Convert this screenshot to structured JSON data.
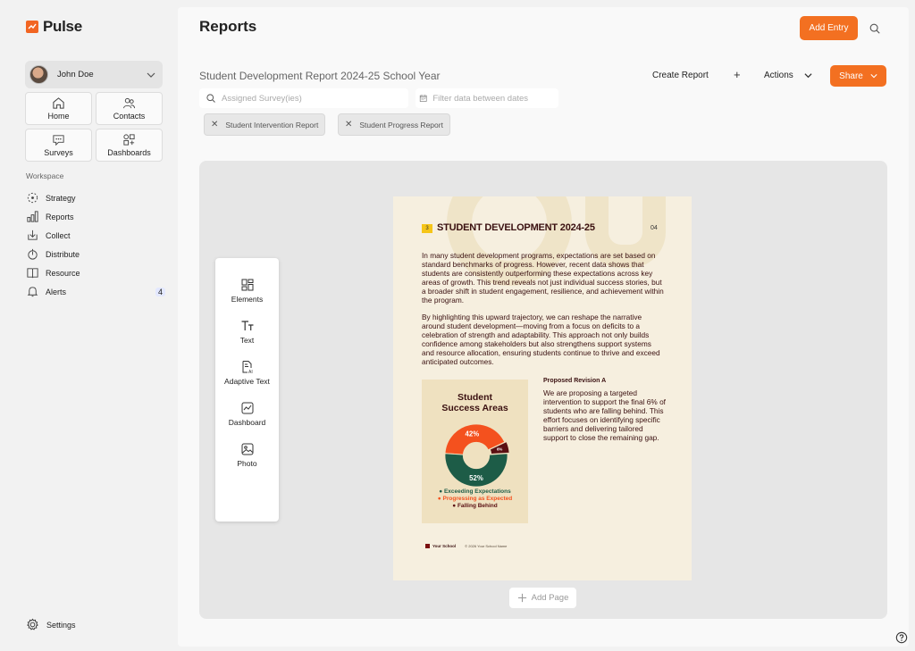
{
  "app": {
    "name": "Pulse",
    "accent": "#f37021"
  },
  "user": {
    "name": "John Doe"
  },
  "nav": {
    "tiles": [
      {
        "label": "Home",
        "icon": "home-icon"
      },
      {
        "label": "Contacts",
        "icon": "contacts-icon"
      },
      {
        "label": "Surveys",
        "icon": "surveys-icon"
      },
      {
        "label": "Dashboards",
        "icon": "dashboards-icon"
      }
    ],
    "workspace_label": "Workspace",
    "workspace": [
      {
        "label": "Strategy",
        "icon": "strategy-icon"
      },
      {
        "label": "Reports",
        "icon": "reports-icon"
      },
      {
        "label": "Collect",
        "icon": "collect-icon"
      },
      {
        "label": "Distribute",
        "icon": "distribute-icon"
      },
      {
        "label": "Resource",
        "icon": "resource-icon"
      },
      {
        "label": "Alerts",
        "icon": "alerts-icon",
        "badge": "4"
      }
    ],
    "settings": "Settings"
  },
  "header": {
    "title": "Reports",
    "add_entry": "Add Entry"
  },
  "report": {
    "title": "Student Development Report 2024-25 School Year",
    "create_report": "Create Report",
    "plus": "+",
    "actions": "Actions",
    "share": "Share",
    "survey_placeholder": "Assigned Survey(ies)",
    "date_placeholder": "Filter data between dates",
    "chips": [
      "Student Intervention Report",
      "Student Progress Report"
    ]
  },
  "tools": [
    {
      "label": "Elements",
      "icon": "elements-icon"
    },
    {
      "label": "Text",
      "icon": "text-icon"
    },
    {
      "label": "Adaptive Text",
      "icon": "adaptive-text-icon"
    },
    {
      "label": "Dashboard",
      "icon": "dashboard-icon"
    },
    {
      "label": "Photo",
      "icon": "photo-icon"
    }
  ],
  "doc": {
    "section_number": "3",
    "heading": "STUDENT DEVELOPMENT 2024-25",
    "page_number": "04",
    "paragraph1": "In many student development programs, expectations are set based on standard benchmarks of progress. However, recent data shows that students are consistently outperforming these expectations across key areas of growth. This trend reveals not just individual success stories, but a broader shift in student engagement, resilience, and achievement within the program.",
    "paragraph2": "By highlighting this upward trajectory, we can reshape the narrative around student development—moving from a focus on deficits to a celebration of strength and adaptability. This approach not only builds confidence among stakeholders but also strengthens support systems and resource allocation, ensuring students continue to thrive and exceed anticipated outcomes.",
    "revision_title": "Proposed Revision A",
    "revision_text": "We are proposing a targeted intervention to support the final 6% of students who are falling behind. This effort focuses on identifying specific barriers and delivering tailored support to close the remaining gap.",
    "footer_logo": "Your School",
    "footer_copy": "© 2026 Your School Name",
    "chart_title_line1": "Student",
    "chart_title_line2": "Success Areas"
  },
  "chart_data": {
    "type": "pie",
    "title": "Student Success Areas",
    "labels": [
      "Exceeding Expectations",
      "Progressing as Expected",
      "Falling Behind"
    ],
    "values": [
      52,
      42,
      6
    ],
    "value_labels": [
      "52%",
      "42%",
      "6%"
    ],
    "colors": [
      "#1d5c47",
      "#f4511e",
      "#5a0f12"
    ],
    "donut": true
  },
  "canvas": {
    "add_page": "Add Page"
  }
}
